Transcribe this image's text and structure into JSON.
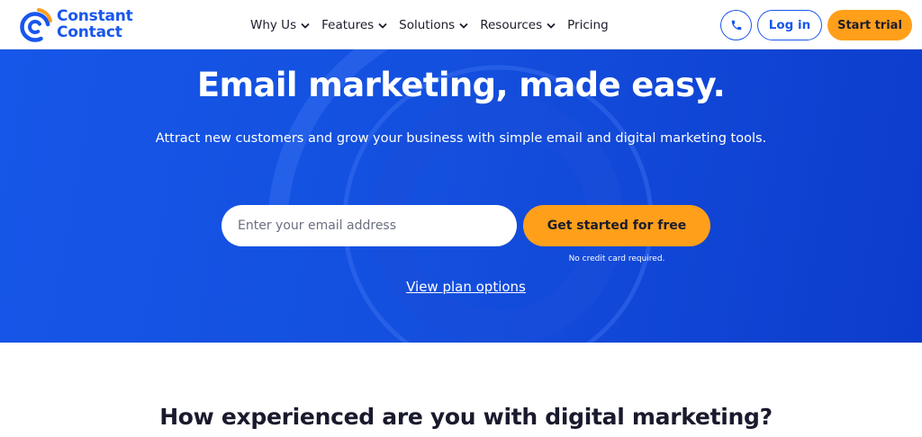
{
  "brand": {
    "name_line1": "Constant",
    "name_line2": "Contact",
    "color": "#1856ed",
    "accent": "#ff9f1a"
  },
  "nav": {
    "items": [
      {
        "label": "Why Us",
        "has_dropdown": true
      },
      {
        "label": "Features",
        "has_dropdown": true
      },
      {
        "label": "Solutions",
        "has_dropdown": true
      },
      {
        "label": "Resources",
        "has_dropdown": true
      },
      {
        "label": "Pricing",
        "has_dropdown": false
      }
    ],
    "phone_icon": "phone-icon",
    "login_label": "Log in",
    "trial_label": "Start trial"
  },
  "hero": {
    "title": "Email marketing, made easy.",
    "subtitle": "Attract new customers and grow your business with simple email and digital marketing tools.",
    "email_placeholder": "Enter your email address",
    "email_value": "",
    "cta_label": "Get started for free",
    "no_credit_card": "No credit card required.",
    "plan_link": "View plan options",
    "background": "#1450df"
  },
  "section": {
    "title": "How experienced are you with digital marketing?"
  }
}
